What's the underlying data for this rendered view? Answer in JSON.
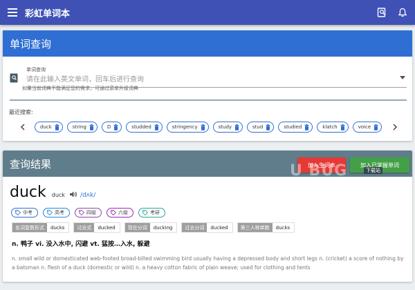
{
  "app": {
    "title": "彩虹单词本"
  },
  "search_card": {
    "title": "单词查询",
    "field_label": "单词查询",
    "placeholder": "请在此输入英文单词，回车后进行查询",
    "hint": "如果当前词典不能满足您的需求，可通过菜单升级词典",
    "recent_label": "最近搜索:",
    "recent": [
      "duck",
      "string",
      "D",
      "studded",
      "stringency",
      "study",
      "stud",
      "studied",
      "klatch",
      "voice"
    ]
  },
  "result_card": {
    "title": "查询结果",
    "add_new_label": "加入生词本",
    "add_mastered_label": "加入已掌握单词",
    "word": "duck",
    "word_small": "duck",
    "phonetic": "/dʌk/",
    "tags": [
      {
        "label": "中考",
        "color": "#2f6fd4"
      },
      {
        "label": "高考",
        "color": "#1e88e5"
      },
      {
        "label": "四级",
        "color": "#8e44ad"
      },
      {
        "label": "六级",
        "color": "#9c27b0"
      },
      {
        "label": "考研",
        "color": "#26a69a"
      }
    ],
    "forms": [
      {
        "label": "名词复数形式",
        "value": "ducks"
      },
      {
        "label": "过去式",
        "value": "ducked"
      },
      {
        "label": "现在分词",
        "value": "ducking"
      },
      {
        "label": "过去分词",
        "value": "ducked"
      },
      {
        "label": "第三人称单数",
        "value": "ducks"
      }
    ],
    "definition_cn": "n. 鸭子 vi. 没入水中, 闪避 vt. 猛按…入水, 躲避",
    "definition_en": "n. small wild or domesticated web-footed broad-billed swimming bird usually having a depressed body and short legs n. (cricket) a score of nothing by a batsman n. flesh of a duck (domestic or wild) n. a heavy cotton fabric of plain weave; used for clothing and tents"
  },
  "watermark": {
    "text": "U BUG",
    "tag": "下载站"
  },
  "colors": {
    "appbar": "#3f51b5",
    "search_header": "#2f6fd4",
    "result_header": "#607d8b",
    "add_new": "#e53935",
    "add_mastered": "#43a047"
  }
}
